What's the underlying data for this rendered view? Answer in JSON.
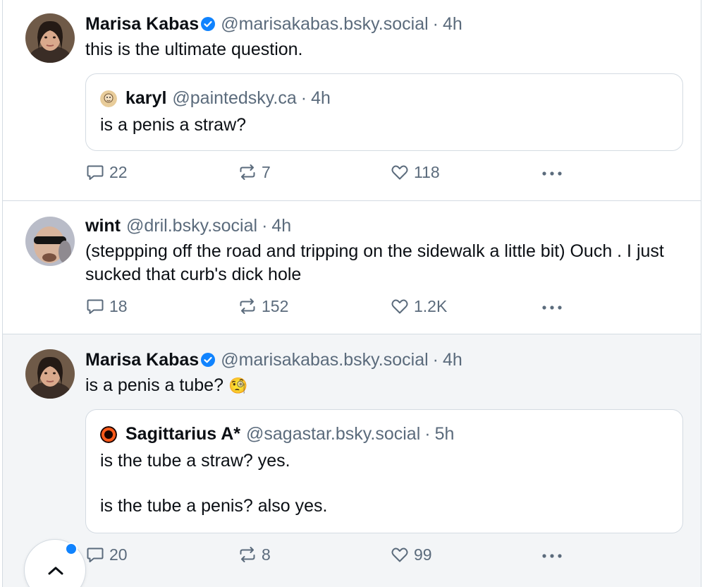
{
  "posts": [
    {
      "author": "Marisa Kabas",
      "handle": "@marisakabas.bsky.social",
      "sep": "·",
      "time": "4h",
      "text": "this is the ultimate question.",
      "quote": {
        "author": "karyl",
        "handle": "@paintedsky.ca",
        "sep": "·",
        "time": "4h",
        "text_lines": [
          "is a penis a straw?"
        ]
      },
      "replies": "22",
      "reposts": "7",
      "likes": "118"
    },
    {
      "author": "wint",
      "handle": "@dril.bsky.social",
      "sep": "·",
      "time": "4h",
      "text": "(steppping off the road and tripping on the sidewalk a little bit) Ouch . I just sucked that curb's dick hole",
      "replies": "18",
      "reposts": "152",
      "likes": "1.2K"
    },
    {
      "author": "Marisa Kabas",
      "handle": "@marisakabas.bsky.social",
      "sep": "·",
      "time": "4h",
      "text": "is a penis a tube?",
      "emoji": "🧐",
      "quote": {
        "author": "Sagittarius A*",
        "handle": "@sagastar.bsky.social",
        "sep": "·",
        "time": "5h",
        "text_lines": [
          "is the tube a straw? yes.",
          "is the tube a penis? also yes."
        ]
      },
      "replies": "20",
      "reposts": "8",
      "likes": "99"
    }
  ],
  "colors": {
    "muted": "#5b6b7c",
    "border": "#d4dbe2",
    "accent": "#1083fe",
    "highlight_bg": "#f3f5f7"
  },
  "icons": [
    "verified-badge-icon",
    "reply-icon",
    "repost-icon",
    "like-icon",
    "more-icon",
    "chevron-up-icon"
  ]
}
